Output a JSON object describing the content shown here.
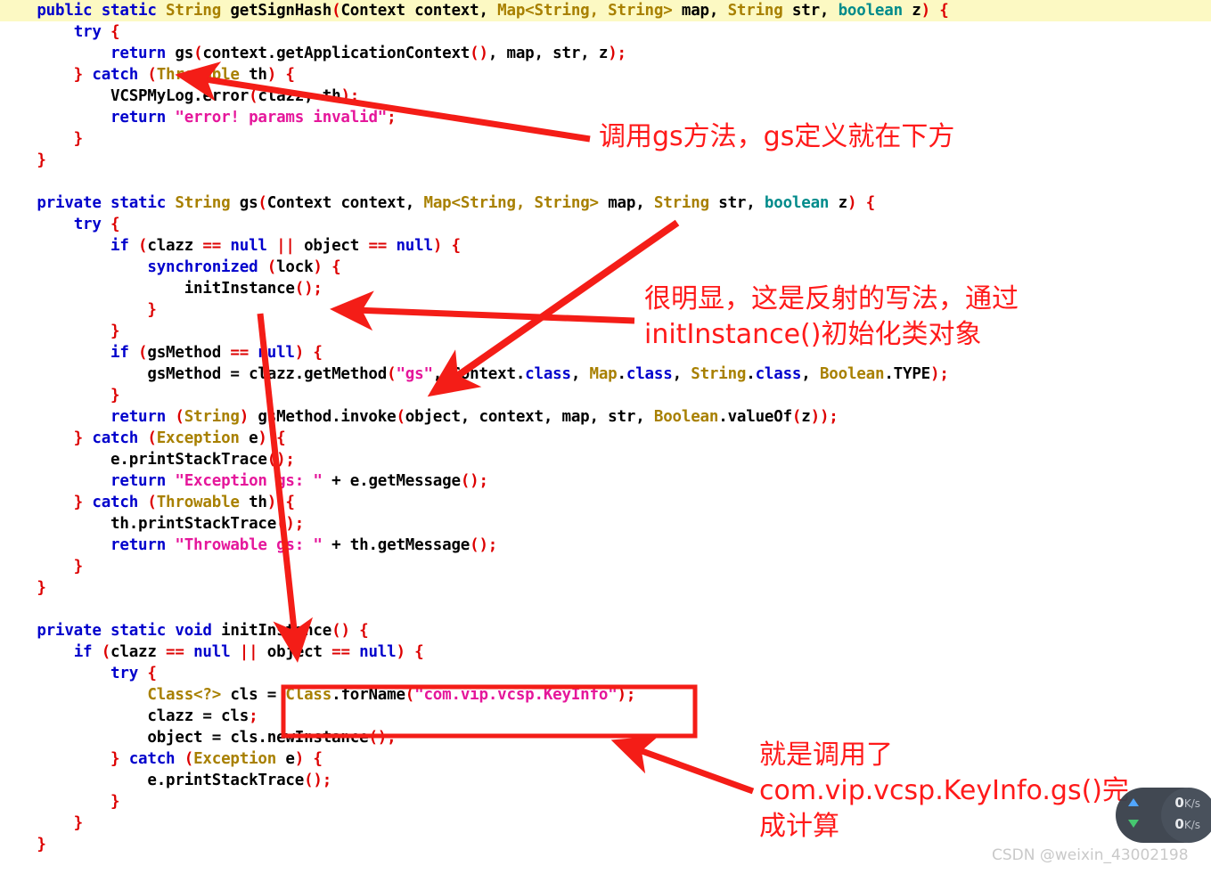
{
  "code": {
    "language": "java",
    "highlighted_line_index": 0,
    "lines": [
      [
        {
          "t": "    ",
          "c": "plain"
        },
        {
          "t": "public static ",
          "c": "kw"
        },
        {
          "t": "String",
          "c": "type"
        },
        {
          "t": " getSignHash",
          "c": "meth"
        },
        {
          "t": "(",
          "c": "punct"
        },
        {
          "t": "Context context, ",
          "c": "plain"
        },
        {
          "t": "Map<String, String>",
          "c": "type"
        },
        {
          "t": " map, ",
          "c": "plain"
        },
        {
          "t": "String",
          "c": "type"
        },
        {
          "t": " str, ",
          "c": "plain"
        },
        {
          "t": "boolean",
          "c": "bool"
        },
        {
          "t": " z",
          "c": "plain"
        },
        {
          "t": ") {",
          "c": "punct"
        }
      ],
      [
        {
          "t": "        ",
          "c": "plain"
        },
        {
          "t": "try",
          "c": "kw"
        },
        {
          "t": " {",
          "c": "punct"
        }
      ],
      [
        {
          "t": "            ",
          "c": "plain"
        },
        {
          "t": "return",
          "c": "kw"
        },
        {
          "t": " gs",
          "c": "plain"
        },
        {
          "t": "(",
          "c": "punct"
        },
        {
          "t": "context.getApplicationContext",
          "c": "plain"
        },
        {
          "t": "()",
          "c": "punct"
        },
        {
          "t": ", map, str, z",
          "c": "plain"
        },
        {
          "t": ");",
          "c": "punct"
        }
      ],
      [
        {
          "t": "        } ",
          "c": "punct"
        },
        {
          "t": "catch",
          "c": "kw"
        },
        {
          "t": " (",
          "c": "punct"
        },
        {
          "t": "Throwable",
          "c": "type"
        },
        {
          "t": " th",
          "c": "plain"
        },
        {
          "t": ") {",
          "c": "punct"
        }
      ],
      [
        {
          "t": "            VCSPMyLog.error",
          "c": "plain"
        },
        {
          "t": "(",
          "c": "punct"
        },
        {
          "t": "clazz, th",
          "c": "plain"
        },
        {
          "t": ");",
          "c": "punct"
        }
      ],
      [
        {
          "t": "            ",
          "c": "plain"
        },
        {
          "t": "return",
          "c": "kw"
        },
        {
          "t": " ",
          "c": "plain"
        },
        {
          "t": "\"error! params invalid\"",
          "c": "str"
        },
        {
          "t": ";",
          "c": "punct"
        }
      ],
      [
        {
          "t": "        }",
          "c": "punct"
        }
      ],
      [
        {
          "t": "    }",
          "c": "punct"
        }
      ],
      [
        {
          "t": "",
          "c": "plain"
        }
      ],
      [
        {
          "t": "    ",
          "c": "plain"
        },
        {
          "t": "private static ",
          "c": "kw"
        },
        {
          "t": "String",
          "c": "type"
        },
        {
          "t": " gs",
          "c": "meth"
        },
        {
          "t": "(",
          "c": "punct"
        },
        {
          "t": "Context context, ",
          "c": "plain"
        },
        {
          "t": "Map<String, String>",
          "c": "type"
        },
        {
          "t": " map, ",
          "c": "plain"
        },
        {
          "t": "String",
          "c": "type"
        },
        {
          "t": " str, ",
          "c": "plain"
        },
        {
          "t": "boolean",
          "c": "bool"
        },
        {
          "t": " z",
          "c": "plain"
        },
        {
          "t": ") {",
          "c": "punct"
        }
      ],
      [
        {
          "t": "        ",
          "c": "plain"
        },
        {
          "t": "try",
          "c": "kw"
        },
        {
          "t": " {",
          "c": "punct"
        }
      ],
      [
        {
          "t": "            ",
          "c": "plain"
        },
        {
          "t": "if",
          "c": "kw"
        },
        {
          "t": " (",
          "c": "punct"
        },
        {
          "t": "clazz ",
          "c": "plain"
        },
        {
          "t": "== ",
          "c": "punct"
        },
        {
          "t": "null",
          "c": "kw"
        },
        {
          "t": " || ",
          "c": "punct"
        },
        {
          "t": "object ",
          "c": "plain"
        },
        {
          "t": "== ",
          "c": "punct"
        },
        {
          "t": "null",
          "c": "kw"
        },
        {
          "t": ") {",
          "c": "punct"
        }
      ],
      [
        {
          "t": "                ",
          "c": "plain"
        },
        {
          "t": "synchronized",
          "c": "kw"
        },
        {
          "t": " (",
          "c": "punct"
        },
        {
          "t": "lock",
          "c": "plain"
        },
        {
          "t": ") {",
          "c": "punct"
        }
      ],
      [
        {
          "t": "                    initInstance",
          "c": "plain"
        },
        {
          "t": "();",
          "c": "punct"
        }
      ],
      [
        {
          "t": "                }",
          "c": "punct"
        }
      ],
      [
        {
          "t": "            }",
          "c": "punct"
        }
      ],
      [
        {
          "t": "            ",
          "c": "plain"
        },
        {
          "t": "if",
          "c": "kw"
        },
        {
          "t": " (",
          "c": "punct"
        },
        {
          "t": "gsMethod ",
          "c": "plain"
        },
        {
          "t": "== ",
          "c": "punct"
        },
        {
          "t": "null",
          "c": "kw"
        },
        {
          "t": ") {",
          "c": "punct"
        }
      ],
      [
        {
          "t": "                gsMethod = clazz.getMethod",
          "c": "plain"
        },
        {
          "t": "(",
          "c": "punct"
        },
        {
          "t": "\"gs\"",
          "c": "str"
        },
        {
          "t": ", Context.",
          "c": "plain"
        },
        {
          "t": "class",
          "c": "cls"
        },
        {
          "t": ", ",
          "c": "plain"
        },
        {
          "t": "Map",
          "c": "type"
        },
        {
          "t": ".",
          "c": "plain"
        },
        {
          "t": "class",
          "c": "cls"
        },
        {
          "t": ", ",
          "c": "plain"
        },
        {
          "t": "String",
          "c": "type"
        },
        {
          "t": ".",
          "c": "plain"
        },
        {
          "t": "class",
          "c": "cls"
        },
        {
          "t": ", ",
          "c": "plain"
        },
        {
          "t": "Boolean",
          "c": "type"
        },
        {
          "t": ".TYPE",
          "c": "plain"
        },
        {
          "t": ");",
          "c": "punct"
        }
      ],
      [
        {
          "t": "            }",
          "c": "punct"
        }
      ],
      [
        {
          "t": "            ",
          "c": "plain"
        },
        {
          "t": "return",
          "c": "kw"
        },
        {
          "t": " (",
          "c": "punct"
        },
        {
          "t": "String",
          "c": "type"
        },
        {
          "t": ") ",
          "c": "punct"
        },
        {
          "t": "gsMethod.invoke",
          "c": "plain"
        },
        {
          "t": "(",
          "c": "punct"
        },
        {
          "t": "object, context, map, str, ",
          "c": "plain"
        },
        {
          "t": "Boolean",
          "c": "type"
        },
        {
          "t": ".valueOf",
          "c": "plain"
        },
        {
          "t": "(",
          "c": "punct"
        },
        {
          "t": "z",
          "c": "plain"
        },
        {
          "t": "));",
          "c": "punct"
        }
      ],
      [
        {
          "t": "        } ",
          "c": "punct"
        },
        {
          "t": "catch",
          "c": "kw"
        },
        {
          "t": " (",
          "c": "punct"
        },
        {
          "t": "Exception",
          "c": "type"
        },
        {
          "t": " e",
          "c": "plain"
        },
        {
          "t": ") {",
          "c": "punct"
        }
      ],
      [
        {
          "t": "            e.printStackTrace",
          "c": "plain"
        },
        {
          "t": "();",
          "c": "punct"
        }
      ],
      [
        {
          "t": "            ",
          "c": "plain"
        },
        {
          "t": "return",
          "c": "kw"
        },
        {
          "t": " ",
          "c": "plain"
        },
        {
          "t": "\"Exception gs: \"",
          "c": "str"
        },
        {
          "t": " + e.getMessage",
          "c": "plain"
        },
        {
          "t": "();",
          "c": "punct"
        }
      ],
      [
        {
          "t": "        } ",
          "c": "punct"
        },
        {
          "t": "catch",
          "c": "kw"
        },
        {
          "t": " (",
          "c": "punct"
        },
        {
          "t": "Throwable",
          "c": "type"
        },
        {
          "t": " th",
          "c": "plain"
        },
        {
          "t": ") {",
          "c": "punct"
        }
      ],
      [
        {
          "t": "            th.printStackTrace",
          "c": "plain"
        },
        {
          "t": "();",
          "c": "punct"
        }
      ],
      [
        {
          "t": "            ",
          "c": "plain"
        },
        {
          "t": "return",
          "c": "kw"
        },
        {
          "t": " ",
          "c": "plain"
        },
        {
          "t": "\"Throwable gs: \"",
          "c": "str"
        },
        {
          "t": " + th.getMessage",
          "c": "plain"
        },
        {
          "t": "();",
          "c": "punct"
        }
      ],
      [
        {
          "t": "        }",
          "c": "punct"
        }
      ],
      [
        {
          "t": "    }",
          "c": "punct"
        }
      ],
      [
        {
          "t": "",
          "c": "plain"
        }
      ],
      [
        {
          "t": "    ",
          "c": "plain"
        },
        {
          "t": "private static void",
          "c": "kw"
        },
        {
          "t": " initInstance",
          "c": "meth"
        },
        {
          "t": "() {",
          "c": "punct"
        }
      ],
      [
        {
          "t": "        ",
          "c": "plain"
        },
        {
          "t": "if",
          "c": "kw"
        },
        {
          "t": " (",
          "c": "punct"
        },
        {
          "t": "clazz ",
          "c": "plain"
        },
        {
          "t": "== ",
          "c": "punct"
        },
        {
          "t": "null",
          "c": "kw"
        },
        {
          "t": " || ",
          "c": "punct"
        },
        {
          "t": "object ",
          "c": "plain"
        },
        {
          "t": "== ",
          "c": "punct"
        },
        {
          "t": "null",
          "c": "kw"
        },
        {
          "t": ") {",
          "c": "punct"
        }
      ],
      [
        {
          "t": "            ",
          "c": "plain"
        },
        {
          "t": "try",
          "c": "kw"
        },
        {
          "t": " {",
          "c": "punct"
        }
      ],
      [
        {
          "t": "                ",
          "c": "plain"
        },
        {
          "t": "Class<?>",
          "c": "type"
        },
        {
          "t": " cls = ",
          "c": "plain"
        },
        {
          "t": "Class",
          "c": "type"
        },
        {
          "t": ".forName",
          "c": "plain"
        },
        {
          "t": "(",
          "c": "punct"
        },
        {
          "t": "\"com.vip.vcsp.KeyInfo\"",
          "c": "str"
        },
        {
          "t": ");",
          "c": "punct"
        }
      ],
      [
        {
          "t": "                clazz = cls",
          "c": "plain"
        },
        {
          "t": ";",
          "c": "punct"
        }
      ],
      [
        {
          "t": "                object = cls.newInstance",
          "c": "plain"
        },
        {
          "t": "();",
          "c": "punct"
        }
      ],
      [
        {
          "t": "            } ",
          "c": "punct"
        },
        {
          "t": "catch",
          "c": "kw"
        },
        {
          "t": " (",
          "c": "punct"
        },
        {
          "t": "Exception",
          "c": "type"
        },
        {
          "t": " e",
          "c": "plain"
        },
        {
          "t": ") {",
          "c": "punct"
        }
      ],
      [
        {
          "t": "                e.printStackTrace",
          "c": "plain"
        },
        {
          "t": "();",
          "c": "punct"
        }
      ],
      [
        {
          "t": "            }",
          "c": "punct"
        }
      ],
      [
        {
          "t": "        }",
          "c": "punct"
        }
      ],
      [
        {
          "t": "    }",
          "c": "punct"
        }
      ]
    ]
  },
  "annotations": {
    "color": "#ff1a1a",
    "note_1": "调用gs方法，gs定义就在下方",
    "note_2": "很明显，这是反射的写法，通过\ninitInstance()初始化类对象",
    "note_3": "就是调用了\ncom.vip.vcsp.KeyInfo.gs()完\n成计算",
    "highlight_box_label": "Class.forName(\"com.vip.vcsp.KeyInfo\");"
  },
  "widgets": {
    "netspeed": {
      "upload_value": "0",
      "upload_unit": "K/s",
      "download_value": "0",
      "download_unit": "K/s"
    },
    "watermark": "CSDN @weixin_43002198"
  }
}
